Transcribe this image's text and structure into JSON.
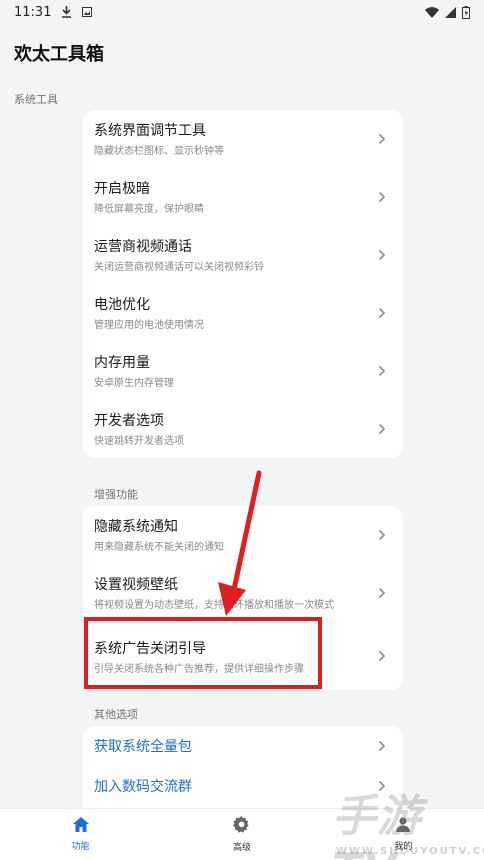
{
  "status_bar": {
    "time": "11:31"
  },
  "app": {
    "title": "欢太工具箱"
  },
  "sections": [
    {
      "label": "系统工具",
      "items": [
        {
          "title": "系统界面调节工具",
          "subtitle": "隐藏状态栏图标、显示秒钟等"
        },
        {
          "title": "开启极暗",
          "subtitle": "降低屏幕亮度，保护眼睛"
        },
        {
          "title": "运营商视频通话",
          "subtitle": "关闭运营商视频通话可以关闭视频彩铃"
        },
        {
          "title": "电池优化",
          "subtitle": "管理应用的电池使用情况"
        },
        {
          "title": "内存用量",
          "subtitle": "安卓原生内存管理"
        },
        {
          "title": "开发者选项",
          "subtitle": "快速跳转开发者选项"
        }
      ]
    },
    {
      "label": "增强功能",
      "items": [
        {
          "title": "隐藏系统通知",
          "subtitle": "用来隐藏系统不能关闭的通知"
        },
        {
          "title": "设置视频壁纸",
          "subtitle": "将视频设置为动态壁纸，支持循环播放和播放一次模式"
        },
        {
          "title": "系统广告关闭引导",
          "subtitle": "引导关闭系统各种广告推荐，提供详细操作步骤"
        }
      ]
    },
    {
      "label": "其他选项",
      "items": [
        {
          "title": "获取系统全量包"
        },
        {
          "title": "加入数码交流群"
        }
      ]
    }
  ],
  "bottom_nav": [
    {
      "label": "功能",
      "icon": "home-icon",
      "active": true
    },
    {
      "label": "高级",
      "icon": "gear-icon",
      "active": false
    },
    {
      "label": "我的",
      "icon": "person-icon",
      "active": false
    }
  ],
  "watermark": {
    "text": "手游TV",
    "url": "WWW.SHOUYOUTV.COM"
  },
  "colors": {
    "accent": "#1f6ed4",
    "highlight": "#e11e1e",
    "background": "#f3f4f6"
  }
}
